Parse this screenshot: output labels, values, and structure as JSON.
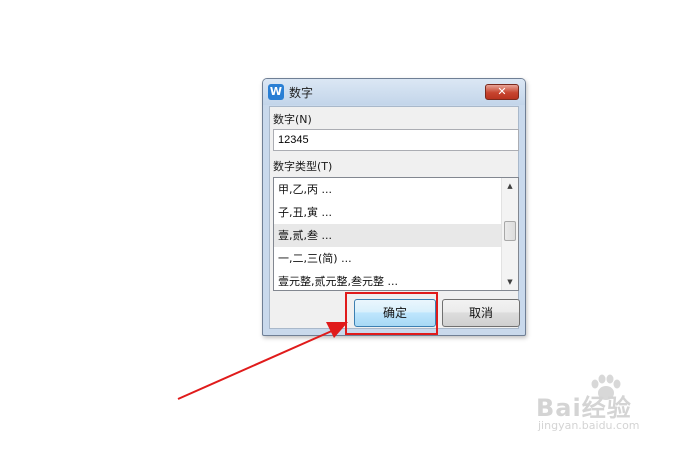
{
  "dialog": {
    "title": "数字",
    "app_icon": "W",
    "close_glyph": "✕",
    "number_label": "数字(N)",
    "number_value": "12345",
    "type_label": "数字类型(T)",
    "type_options": [
      "甲,乙,丙 ...",
      "子,丑,寅 ...",
      "壹,贰,叁 ...",
      "一,二,三(简) ...",
      "壹元整,贰元整,叁元整 ..."
    ],
    "selected_option": "壹,贰,叁 ...",
    "ok_label": "确定",
    "cancel_label": "取消"
  },
  "annotation": {
    "highlight_color": "#e01b1b",
    "arrow_color": "#e01b1b"
  },
  "watermark": {
    "main": "Bai经验",
    "sub": "jingyan.baidu.com"
  }
}
